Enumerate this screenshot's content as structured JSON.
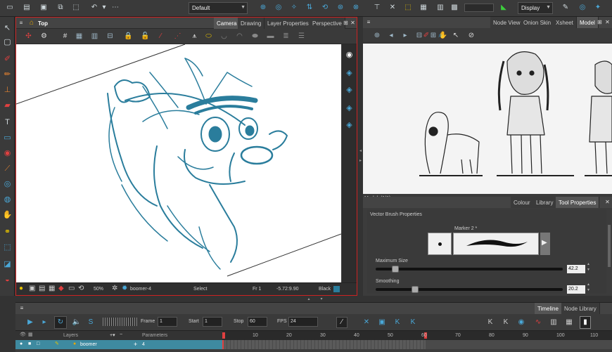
{
  "toolbar": {
    "workspace_select": "Default",
    "display_select": "Display"
  },
  "camera": {
    "title": "Top",
    "tabs": [
      "Camera",
      "Drawing",
      "Layer Properties",
      "Perspective"
    ],
    "status": {
      "zoom": "50%",
      "drawing_name": "boomer-4",
      "tool": "Select",
      "frame": "Fr 1",
      "coords": "-5.72:9.90",
      "color": "Black"
    }
  },
  "model": {
    "tabs": [
      "Node View",
      "Onion Skin",
      "Xsheet",
      "Model"
    ],
    "footer": "Model:  (1/1)"
  },
  "tool_properties": {
    "tabs": [
      "Colour",
      "Library",
      "Tool Properties"
    ],
    "section_title": "Vector Brush Properties",
    "preset_name": "Marker 2 *",
    "max_size_label": "Maximum Size",
    "max_size_value": "42.2",
    "max_size_fraction": 0.09,
    "smoothing_label": "Smoothing",
    "smoothing_value": "20.2",
    "smoothing_fraction": 0.2
  },
  "timeline": {
    "tabs": [
      "Timeline",
      "Node Library"
    ],
    "frame_label": "Frame",
    "frame_value": "1",
    "start_label": "Start",
    "start_value": "1",
    "stop_label": "Stop",
    "stop_value": "60",
    "fps_label": "FPS",
    "fps_value": "24",
    "layers_label": "Layers",
    "parameters_label": "Parameters",
    "layer_name": "boomer",
    "layer_value": "4",
    "ruler_ticks": [
      "10",
      "20",
      "30",
      "40",
      "50",
      "60",
      "70",
      "80",
      "90",
      "100",
      "110"
    ]
  },
  "colors": {
    "accent": "#2a7d9c",
    "active_border": "#cc2222",
    "layer_highlight": "#3e8aa0"
  }
}
